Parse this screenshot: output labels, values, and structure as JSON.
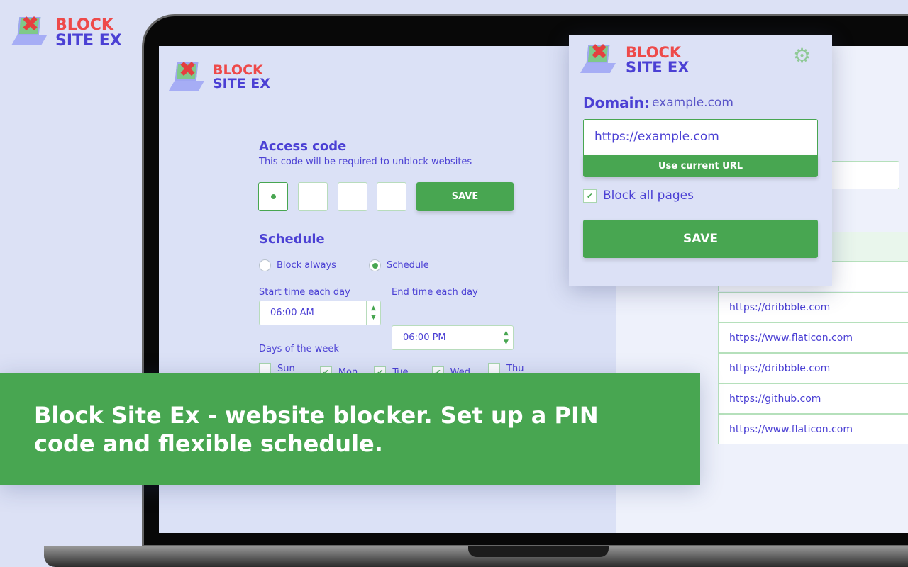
{
  "brand": {
    "line1": "BLOCK",
    "line2": "SITE EX"
  },
  "access": {
    "title": "Access code",
    "subtitle": "This code will be required to unblock websites",
    "save": "SAVE"
  },
  "schedule": {
    "title": "Schedule",
    "opt_always": "Block always",
    "opt_schedule": "Schedule",
    "selected": "Schedule",
    "start_label": "Start time each day",
    "start_value": "06:00 AM",
    "end_label": "End time each day",
    "end_value": "06:00 PM",
    "days_label": "Days of the week",
    "days": [
      {
        "label": "Sun",
        "checked": false
      },
      {
        "label": "Mon",
        "checked": true
      },
      {
        "label": "Tue",
        "checked": true
      },
      {
        "label": "Wed",
        "checked": true
      },
      {
        "label": "Thu",
        "checked": false
      }
    ]
  },
  "popup": {
    "domain_label": "Domain:",
    "domain_value": "example.com",
    "url_value": "https://example.com",
    "use_current": "Use current URL",
    "block_all": "Block all pages",
    "block_all_checked": true,
    "save": "SAVE"
  },
  "sites": [
    "https://dribbble.com",
    "https://www.flaticon.com",
    "https://dribbble.com",
    "https://github.com",
    "https://www.flaticon.com"
  ],
  "banner": "Block Site Ex - website blocker. Set up a PIN code and flexible schedule.",
  "colors": {
    "accent": "#48a651",
    "text": "#4b40d4",
    "brand_red": "#ee4a4a",
    "background": "#dce1f5"
  }
}
